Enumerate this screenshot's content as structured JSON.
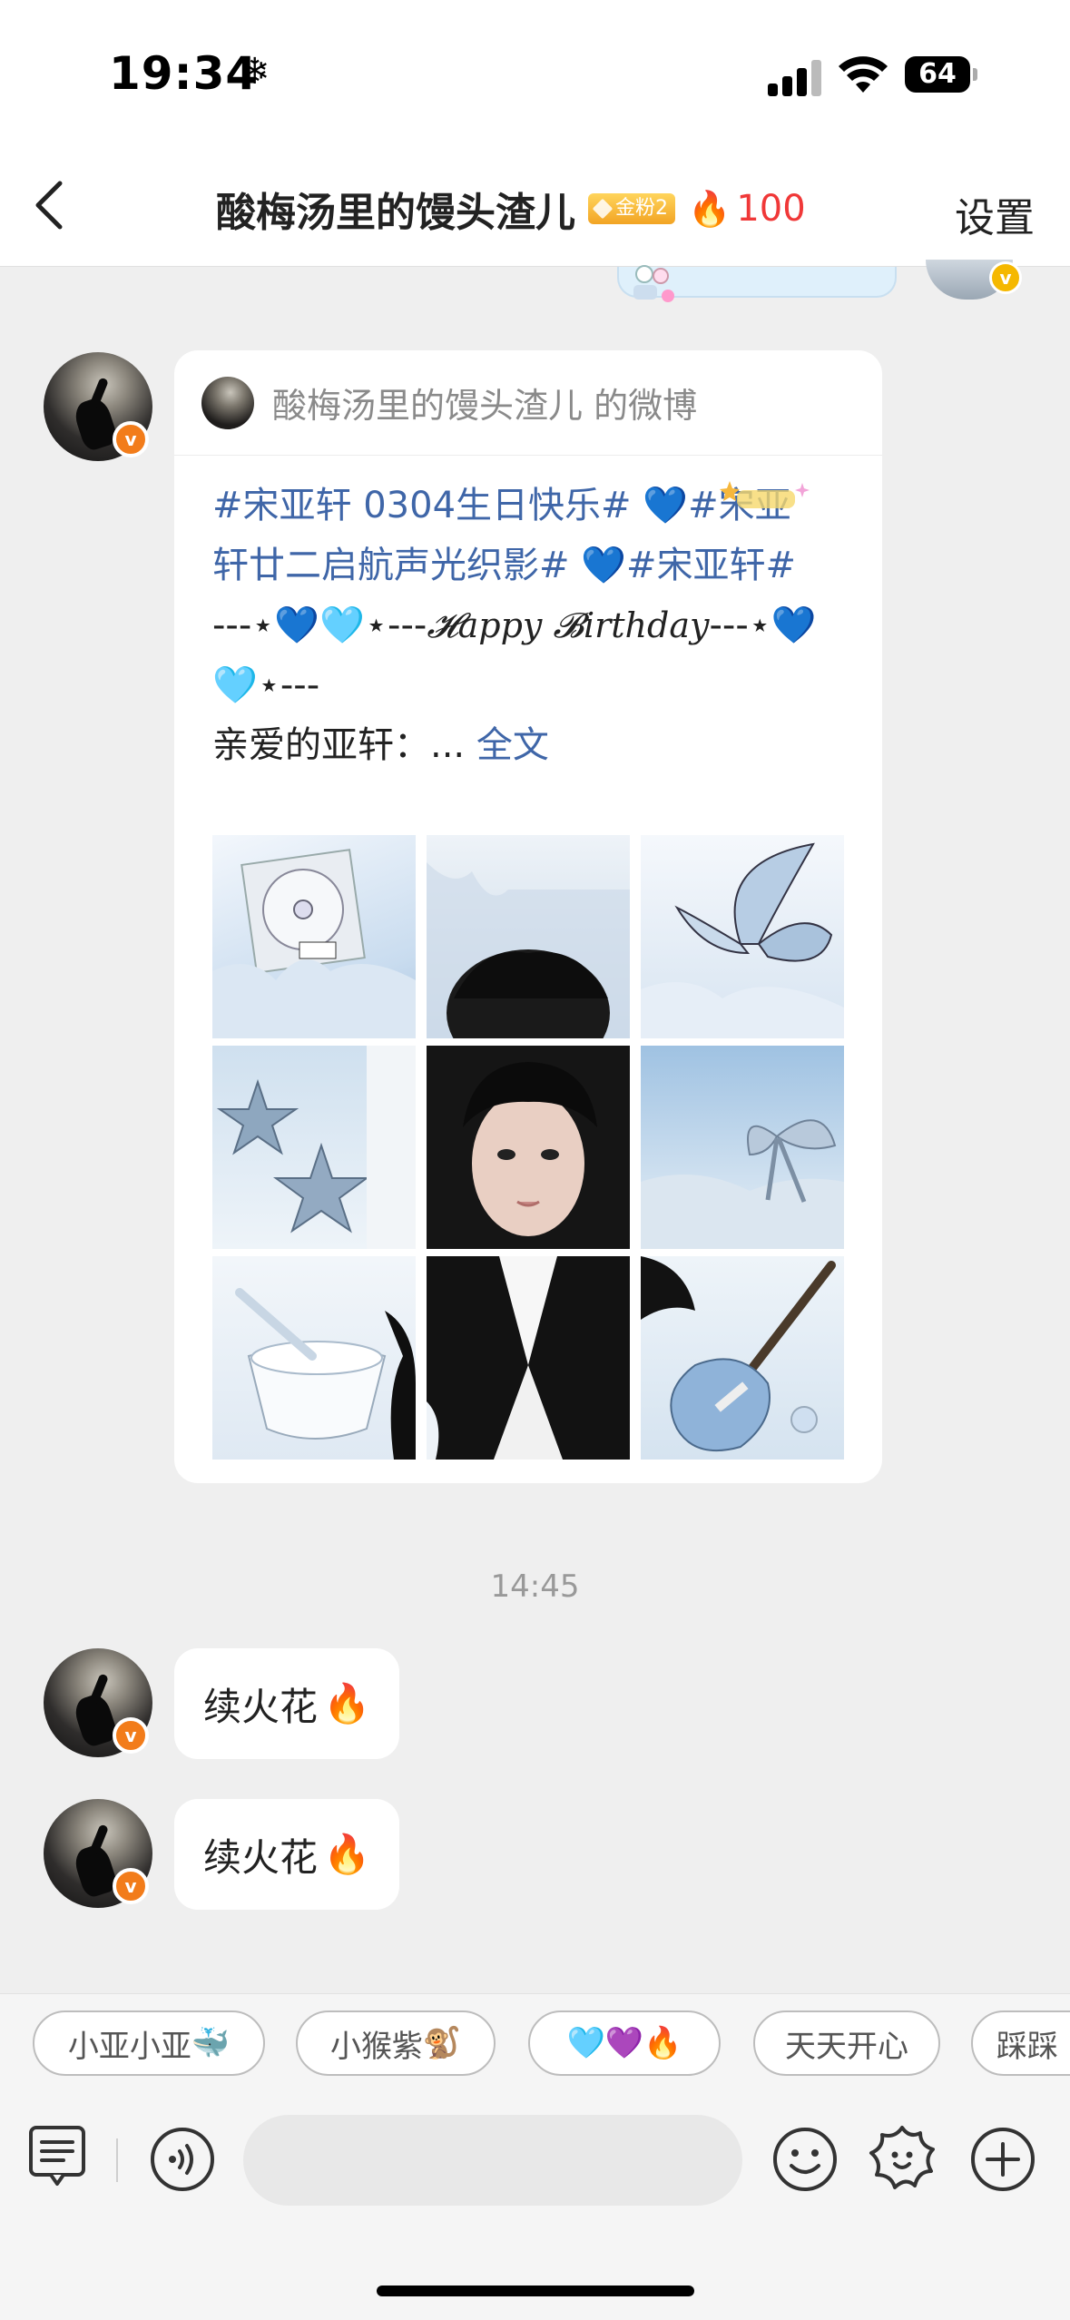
{
  "status_bar": {
    "time": "19:34",
    "weather_glyph": "❄",
    "battery": "64"
  },
  "nav": {
    "title": "酸梅汤里的馒头渣儿",
    "fan_badge": "金粉2",
    "flame_icon": "🔥",
    "flame_count": "100",
    "settings": "设置"
  },
  "card": {
    "header_text": "酸梅汤里的馒头渣儿 的微博",
    "lines": {
      "l1a": "#宋亚轩 0304生日快乐# ",
      "l1b": "💙",
      "l1c": "#宋亚",
      "l2a": "轩廿二启航声光织影# ",
      "l2b": "💙",
      "l2c": "#宋亚轩#",
      "l3a": "---⋆",
      "l3b": "💙",
      "l3c": "🩵",
      "l3d": "⋆---",
      "l3e": "𝓗appy 𝓑irthday",
      "l3f": "---⋆",
      "l3g": "💙",
      "l4a": "🩵",
      "l4b": "⋆---",
      "l5a": "亲爱的亚轩：... ",
      "l5b": "全文"
    },
    "image_count": 9
  },
  "time_separator": "14:45",
  "messages": [
    {
      "text": "续火花",
      "emoji": "🔥"
    },
    {
      "text": "续火花",
      "emoji": "🔥"
    }
  ],
  "quick_replies": [
    {
      "label": "小亚小亚",
      "emoji": "🐳"
    },
    {
      "label": "小猴紫",
      "emoji": "🐒"
    },
    {
      "label": "",
      "emoji": "🩵💜🔥"
    },
    {
      "label": "天天开心",
      "emoji": ""
    },
    {
      "label": "踩踩",
      "emoji": ""
    }
  ],
  "input": {
    "placeholder": ""
  },
  "colors": {
    "link": "#3f66a8",
    "flame_count": "#f03838",
    "badge": "#f2a424",
    "verified": "#f27c1a"
  }
}
